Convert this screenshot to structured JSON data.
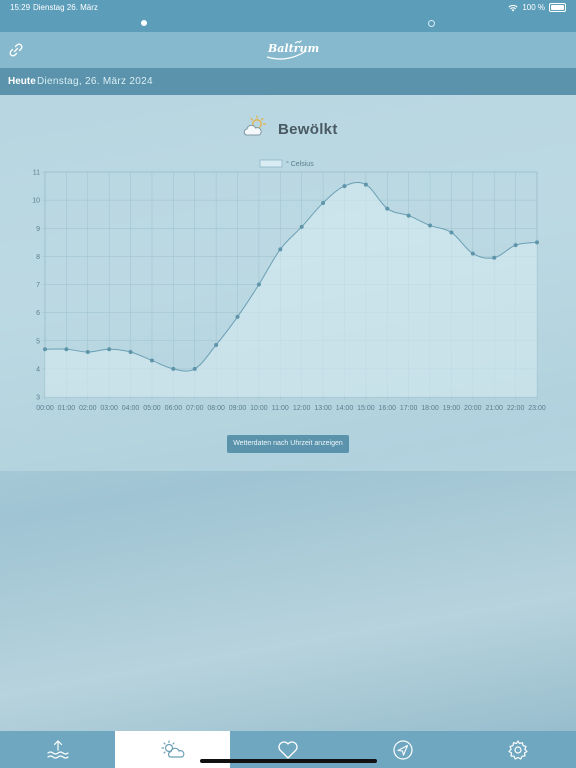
{
  "status": {
    "time": "15:29",
    "date": "Dienstag 26. März",
    "battery": "100 %"
  },
  "nav": {
    "logo_text": "Baltrum",
    "link_icon": "link-icon"
  },
  "datebar": {
    "today_label": "Heute",
    "date_text": "Dienstag, 26. März 2024"
  },
  "weather": {
    "condition": "Bewölkt",
    "icon": "partly-cloudy-sun-icon",
    "show_button_label": "Wetterdaten nach Uhrzeit anzeigen"
  },
  "chart_data": {
    "type": "line",
    "legend": "° Celsius",
    "x": [
      "00:00",
      "01:00",
      "02:00",
      "03:00",
      "04:00",
      "05:00",
      "06:00",
      "07:00",
      "08:00",
      "09:00",
      "10:00",
      "11:00",
      "12:00",
      "13:00",
      "14:00",
      "15:00",
      "16:00",
      "17:00",
      "18:00",
      "19:00",
      "20:00",
      "21:00",
      "22:00",
      "23:00"
    ],
    "series": [
      {
        "name": "° Celsius",
        "values": [
          4.7,
          4.7,
          4.6,
          4.7,
          4.6,
          4.3,
          4.0,
          4.0,
          4.85,
          5.85,
          7.0,
          8.25,
          9.05,
          9.9,
          10.5,
          10.55,
          9.7,
          9.45,
          9.1,
          8.85,
          8.1,
          7.95,
          8.4,
          8.5
        ]
      }
    ],
    "y_ticks": [
      "3",
      "4",
      "5",
      "6",
      "7",
      "8",
      "9",
      "10",
      "11"
    ],
    "ylim": [
      3,
      11
    ],
    "grid": true,
    "legend_position": "top-center",
    "colors": {
      "line": "#6a9fb4",
      "fill": "#d9ecf3",
      "point": "#5f95aa"
    }
  },
  "tabs": [
    {
      "name": "tab-tides",
      "icon": "tide-waves-icon"
    },
    {
      "name": "tab-weather",
      "icon": "sun-cloud-icon",
      "active": true
    },
    {
      "name": "tab-favorites",
      "icon": "heart-icon"
    },
    {
      "name": "tab-navigation",
      "icon": "location-arrow-icon"
    },
    {
      "name": "tab-settings",
      "icon": "gear-icon"
    }
  ]
}
